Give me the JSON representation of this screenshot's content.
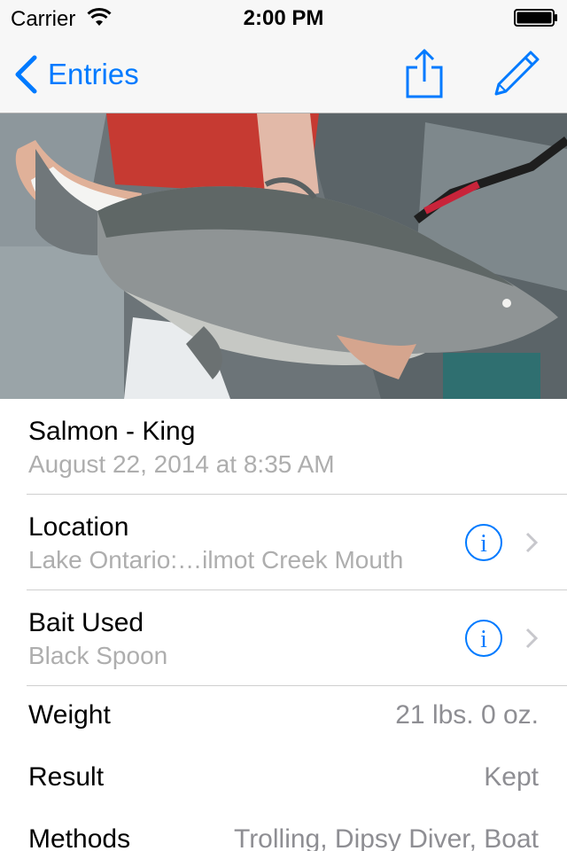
{
  "status_bar": {
    "carrier": "Carrier",
    "time": "2:00 PM"
  },
  "nav": {
    "back_label": "Entries",
    "accent_color": "#007aff"
  },
  "photo": {
    "description_icon": "fish-photo"
  },
  "entry": {
    "species": "Salmon - King",
    "date": "August 22, 2014 at 8:35 AM"
  },
  "location": {
    "label": "Location",
    "value": "Lake Ontario:…ilmot Creek Mouth"
  },
  "bait": {
    "label": "Bait Used",
    "value": "Black Spoon"
  },
  "weight": {
    "label": "Weight",
    "value": "21 lbs. 0 oz."
  },
  "result": {
    "label": "Result",
    "value": "Kept"
  },
  "methods": {
    "label": "Methods",
    "value": "Trolling, Dipsy Diver, Boat"
  }
}
